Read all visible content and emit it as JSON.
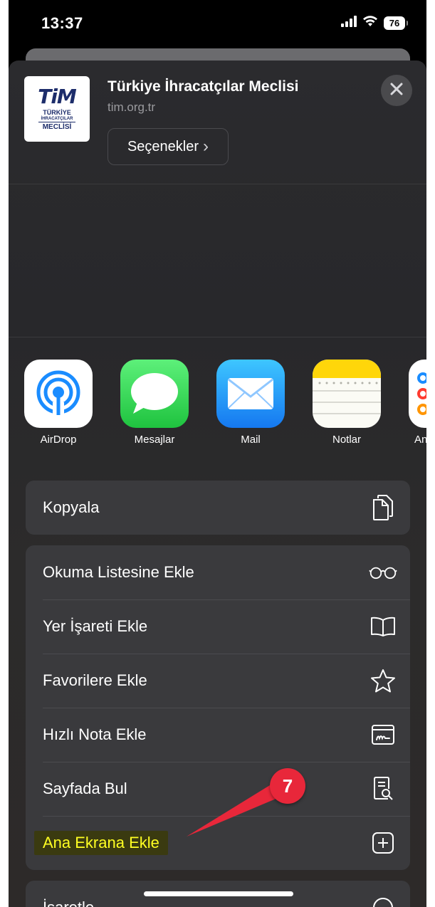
{
  "status_bar": {
    "time": "13:37",
    "battery": "76"
  },
  "site": {
    "title": "Türkiye İhracatçılar Meclisi",
    "url": "tim.org.tr",
    "logo_main": "TiM",
    "logo_line1": "TÜRKİYE",
    "logo_line2": "İHRACATÇILAR",
    "logo_line3": "MECLİSİ"
  },
  "options_button": {
    "label": "Seçenekler",
    "chevron": "›"
  },
  "apps": [
    {
      "label": "AirDrop",
      "icon": "airdrop-icon"
    },
    {
      "label": "Mesajlar",
      "icon": "messages-icon"
    },
    {
      "label": "Mail",
      "icon": "mail-icon"
    },
    {
      "label": "Notlar",
      "icon": "notes-icon"
    },
    {
      "label": "Anımsatıcılar",
      "icon": "reminders-icon",
      "visible_text": "Anı"
    }
  ],
  "actions": {
    "copy": {
      "label": "Kopyala",
      "icon": "copy-icon"
    },
    "list": [
      {
        "label": "Okuma Listesine Ekle",
        "icon": "glasses-icon"
      },
      {
        "label": "Yer İşareti Ekle",
        "icon": "book-icon"
      },
      {
        "label": "Favorilere Ekle",
        "icon": "star-icon"
      },
      {
        "label": "Hızlı Nota Ekle",
        "icon": "quick-note-icon"
      },
      {
        "label": "Sayfada Bul",
        "icon": "find-in-page-icon"
      },
      {
        "label": "Ana Ekrana Ekle",
        "icon": "add-square-icon"
      }
    ],
    "partial": {
      "label": "İşaretle",
      "icon": "markup-icon"
    }
  },
  "annotation": {
    "step": "7",
    "color": "#e8273a",
    "highlight_color": "#ffff22"
  },
  "colors": {
    "sheet_bg": "#2b2b2e",
    "row_bg": "#3a3a3d",
    "messages_green": "#34c759",
    "mail_blue": "#1a8cff",
    "notes_yellow": "#ffd60a"
  }
}
